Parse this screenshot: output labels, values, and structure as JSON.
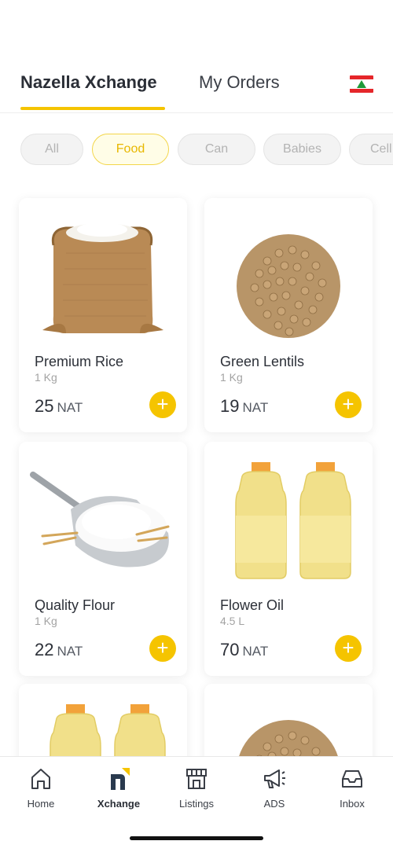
{
  "header": {
    "tabs": [
      {
        "label": "Nazella Xchange",
        "active": true
      },
      {
        "label": "My Orders",
        "active": false
      }
    ],
    "flag_icon": "lebanon-flag-icon",
    "accent_color": "#f5c400"
  },
  "filters": [
    {
      "label": "All",
      "active": false
    },
    {
      "label": "Food",
      "active": true
    },
    {
      "label": "Can",
      "active": false
    },
    {
      "label": "Babies",
      "active": false
    },
    {
      "label": "Cell",
      "active": false
    }
  ],
  "products": [
    {
      "name": "Premium Rice",
      "weight": "1 Kg",
      "price": "25",
      "unit": "NAT",
      "image": "rice-sack-icon"
    },
    {
      "name": "Green Lentils",
      "weight": "1 Kg",
      "price": "19",
      "unit": "NAT",
      "image": "lentils-icon"
    },
    {
      "name": "Quality Flour",
      "weight": "1 Kg",
      "price": "22",
      "unit": "NAT",
      "image": "flour-scoop-icon"
    },
    {
      "name": "Flower Oil",
      "weight": "4.5 L",
      "price": "70",
      "unit": "NAT",
      "image": "oil-bottles-icon"
    }
  ],
  "bottom_nav": [
    {
      "label": "Home",
      "icon": "home-icon",
      "active": false
    },
    {
      "label": "Xchange",
      "icon": "xchange-icon",
      "active": true
    },
    {
      "label": "Listings",
      "icon": "store-icon",
      "active": false
    },
    {
      "label": "ADS",
      "icon": "megaphone-icon",
      "active": false
    },
    {
      "label": "Inbox",
      "icon": "inbox-icon",
      "active": false
    }
  ]
}
